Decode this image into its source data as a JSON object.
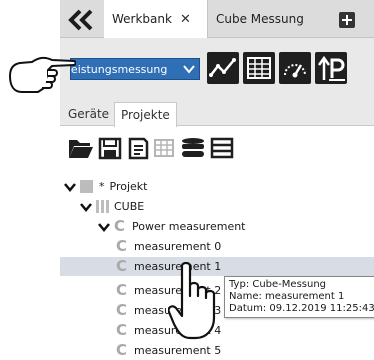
{
  "tabs": [
    {
      "label": "Werkbank",
      "close": "✕"
    },
    {
      "label": "Cube Messung"
    }
  ],
  "toolbar": {
    "mode_select": {
      "value": "Leistungsmessung"
    }
  },
  "panel_tabs": [
    {
      "label": "Geräte"
    },
    {
      "label": "Projekte"
    }
  ],
  "tree": {
    "root": {
      "marker": "*",
      "label": "Projekt"
    },
    "cube": {
      "label": "CUBE"
    },
    "group": {
      "label": "Power measurement"
    },
    "items": [
      {
        "label": "measurement 0"
      },
      {
        "label": "measurement 1"
      },
      {
        "label": "measurement 2"
      },
      {
        "label": "measurement 3"
      },
      {
        "label": "measurement 4"
      },
      {
        "label": "measurement 5"
      }
    ]
  },
  "tooltip": {
    "type": "Typ: Cube-Messung",
    "name": "Name: measurement 1",
    "date": "Datum: 09.12.2019 11:25:43"
  },
  "colors": {
    "select_bg": "#2f6fb6",
    "toolbar_button": "#1f1f1f",
    "selected_row": "#d8dde5",
    "tree_icon": "#a9a9a9"
  }
}
